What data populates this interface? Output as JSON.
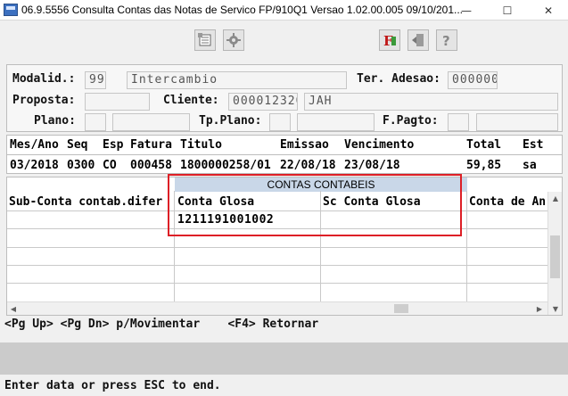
{
  "window": {
    "title": "06.9.5556  Consulta  Contas das Notas de Servico FP/910Q1 Versao 1.02.00.005 09/10/201...",
    "minimize": "—",
    "maximize": "☐",
    "close": "✕"
  },
  "toolbar": {
    "icons": [
      "list-icon",
      "settings-icon",
      "pdf-icon",
      "exit-icon",
      "exit-door-icon",
      "help-icon"
    ]
  },
  "header": {
    "modalid_label": "Modalid.:",
    "modalid_code": "99",
    "modalid_name": "Intercambio",
    "ter_adesao_label": "Ter. Adesao:",
    "ter_adesao_value": "000000",
    "proposta_label": "Proposta:",
    "proposta_value": "",
    "cliente_label": "Cliente:",
    "cliente_code": "000012320",
    "cliente_name": "JAH",
    "plano_label": "Plano:",
    "tp_plano_label": "Tp.Plano:",
    "f_pagto_label": "F.Pagto:"
  },
  "record": {
    "columns": [
      "Mes/Ano",
      "Seq",
      "Esp",
      "Fatura",
      "Titulo",
      "Emissao",
      "Vencimento",
      "Total",
      "Est"
    ],
    "values": [
      "03/2018",
      "0300",
      "CO",
      "000458",
      "1800000258/01",
      "22/08/18",
      "23/08/18",
      "59,85",
      "sa"
    ]
  },
  "grid": {
    "group_header": "CONTAS CONTABEIS",
    "columns": [
      "Sub-Conta contab.difer",
      "Conta Glosa",
      "Sc Conta Glosa",
      "Conta de An"
    ],
    "rows": [
      [
        "",
        "1211191001002",
        "",
        ""
      ]
    ]
  },
  "footer": {
    "hint": "<Pg Up> <Pg Dn> p/Movimentar    <F4> Retornar",
    "status": "Enter data or press ESC to end."
  },
  "colors": {
    "highlight_border": "#dd1f26",
    "group_header_bg": "#c9d7e8"
  }
}
